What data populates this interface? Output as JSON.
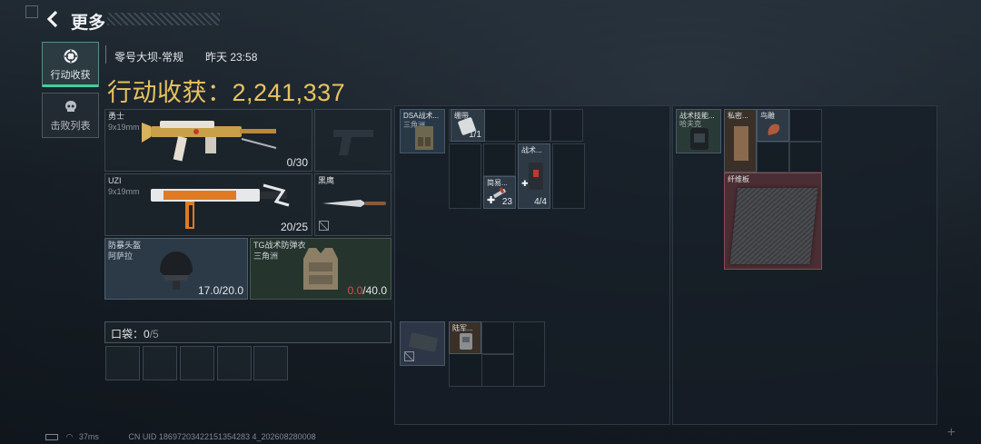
{
  "header": {
    "title": "更多"
  },
  "nav": {
    "tabs": [
      {
        "label": "行动收获"
      },
      {
        "label": "击败列表"
      }
    ]
  },
  "raid": {
    "map": "零号大坝-常规",
    "time": "昨天 23:58",
    "haul_label": "行动收获：",
    "haul_value": "2,241,337"
  },
  "loadout": {
    "primary": {
      "name": "勇士",
      "caliber": "9x19mm",
      "ammo": "0/30"
    },
    "secondary": {
      "name": "UZI",
      "caliber": "9x19mm",
      "ammo": "20/25"
    },
    "melee": {
      "name": "黑鹰"
    },
    "helmet": {
      "name": "防暴头盔",
      "origin": "阿萨拉",
      "durability": "17.0/20.0"
    },
    "armor": {
      "name": "TG战术防弹衣",
      "origin": "三角洲",
      "durability_current": "0.0",
      "durability_max": "/40.0"
    }
  },
  "pocket": {
    "label": "口袋：",
    "current": "0",
    "max": "/5"
  },
  "chest_rig": {
    "title": "DSA战术...",
    "subtitle": "三角洲",
    "items": [
      {
        "name": "绷带",
        "count": "1/1"
      },
      {
        "name": "简易...",
        "count": "23"
      },
      {
        "name": "战术...",
        "count": "4/4"
      }
    ]
  },
  "backpack": {
    "title": "陆军...",
    "pouch_title": ""
  },
  "right_panel": {
    "items": [
      {
        "name": "战术技能...",
        "subtitle": "哈夫克"
      },
      {
        "name": "私密..."
      },
      {
        "name": "鸟雕"
      },
      {
        "name": "纤维板"
      }
    ]
  },
  "status": {
    "ping": "37ms",
    "uid": "CN UID 18697203422151354283 4_202608280008"
  },
  "colors": {
    "accent": "#3fd19a",
    "haul": "#e8c35e",
    "danger": "#e04a4a"
  }
}
